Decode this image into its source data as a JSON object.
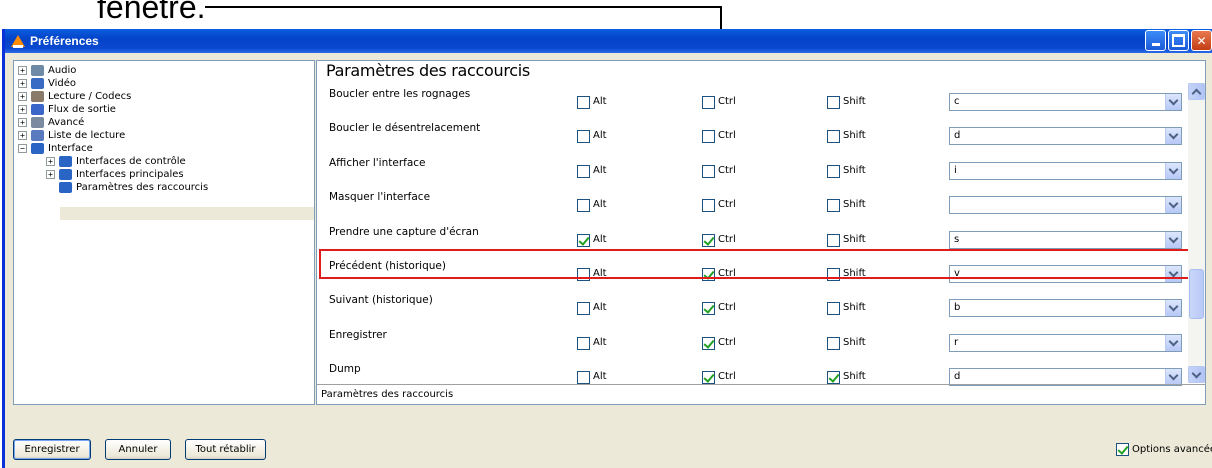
{
  "annotation": {
    "text": "fenêtre."
  },
  "window": {
    "title": "Préférences"
  },
  "tree": {
    "items": [
      {
        "label": "Audio",
        "expander": "+",
        "icon_color": "#6e8aa6"
      },
      {
        "label": "Vidéo",
        "expander": "+",
        "icon_color": "#3a6bc4"
      },
      {
        "label": "Lecture / Codecs",
        "expander": "+",
        "icon_color": "#8a7a6a"
      },
      {
        "label": "Flux de sortie",
        "expander": "+",
        "icon_color": "#3b66c9"
      },
      {
        "label": "Avancé",
        "expander": "+",
        "icon_color": "#7a8aa0"
      },
      {
        "label": "Liste de lecture",
        "expander": "+",
        "icon_color": "#5a7ac0"
      },
      {
        "label": "Interface",
        "expander": "−",
        "icon_color": "#2a64c4"
      }
    ],
    "subitems": [
      {
        "label": "Interfaces de contrôle",
        "expander": "+"
      },
      {
        "label": "Interfaces principales",
        "expander": "+"
      },
      {
        "label": "Paramètres des raccourcis",
        "expander": ""
      }
    ]
  },
  "content": {
    "title": "Paramètres des raccourcis",
    "footer": "Paramètres des raccourcis",
    "labels": {
      "alt": "Alt",
      "ctrl": "Ctrl",
      "shift": "Shift"
    },
    "rows": [
      {
        "label": "Boucler entre les rognages",
        "alt": false,
        "ctrl": false,
        "shift": false,
        "key": "c"
      },
      {
        "label": "Boucler le désentrelacement",
        "alt": false,
        "ctrl": false,
        "shift": false,
        "key": "d"
      },
      {
        "label": "Afficher l'interface",
        "alt": false,
        "ctrl": false,
        "shift": false,
        "key": "i"
      },
      {
        "label": "Masquer l'interface",
        "alt": false,
        "ctrl": false,
        "shift": false,
        "key": ""
      },
      {
        "label": "Prendre une capture d'écran",
        "alt": true,
        "ctrl": true,
        "shift": false,
        "key": "s"
      },
      {
        "label": "Précédent (historique)",
        "alt": false,
        "ctrl": true,
        "shift": false,
        "key": "v"
      },
      {
        "label": "Suivant (historique)",
        "alt": false,
        "ctrl": true,
        "shift": false,
        "key": "b"
      },
      {
        "label": "Enregistrer",
        "alt": false,
        "ctrl": true,
        "shift": false,
        "key": "r"
      },
      {
        "label": "Dump",
        "alt": false,
        "ctrl": true,
        "shift": true,
        "key": "d"
      }
    ]
  },
  "buttons": {
    "save": "Enregistrer",
    "cancel": "Annuler",
    "reset": "Tout rétablir"
  },
  "advanced": {
    "label": "Options avancées",
    "checked": true
  },
  "colors": {
    "highlight": "#e01b1b",
    "titlebar": "#0a5fe0",
    "check": "#21a121"
  }
}
